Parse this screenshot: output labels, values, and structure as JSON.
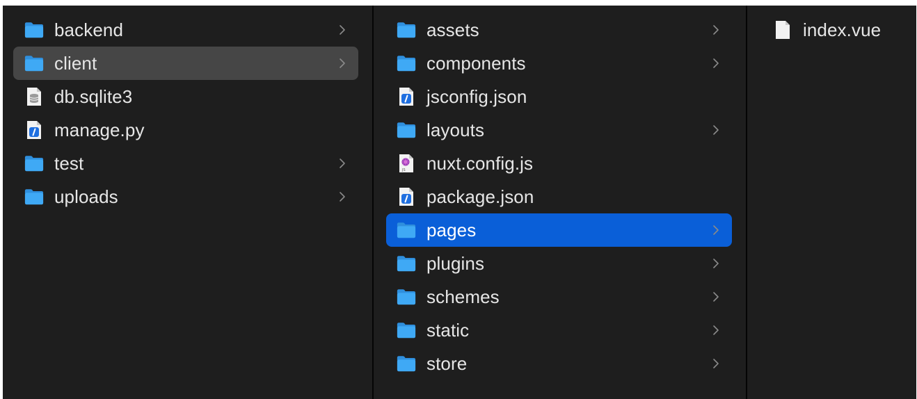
{
  "colors": {
    "background": "#1e1e1e",
    "text": "#e6e6e6",
    "selection_active": "#0a5fd8",
    "selection_inactive": "#464646",
    "folder": "#3fa9f5",
    "chevron": "#8a8a8a"
  },
  "columns": [
    {
      "items": [
        {
          "label": "backend",
          "icon": "folder-icon",
          "has_children": true,
          "state": "none"
        },
        {
          "label": "client",
          "icon": "folder-icon",
          "has_children": true,
          "state": "selected-inactive"
        },
        {
          "label": "db.sqlite3",
          "icon": "database-file-icon",
          "has_children": false,
          "state": "none"
        },
        {
          "label": "manage.py",
          "icon": "script-file-icon",
          "has_children": false,
          "state": "none"
        },
        {
          "label": "test",
          "icon": "folder-icon",
          "has_children": true,
          "state": "none"
        },
        {
          "label": "uploads",
          "icon": "folder-icon",
          "has_children": true,
          "state": "none"
        }
      ]
    },
    {
      "items": [
        {
          "label": "assets",
          "icon": "folder-icon",
          "has_children": true,
          "state": "none"
        },
        {
          "label": "components",
          "icon": "folder-icon",
          "has_children": true,
          "state": "none"
        },
        {
          "label": "jsconfig.json",
          "icon": "script-file-icon",
          "has_children": false,
          "state": "none"
        },
        {
          "label": "layouts",
          "icon": "folder-icon",
          "has_children": true,
          "state": "none"
        },
        {
          "label": "nuxt.config.js",
          "icon": "js-file-icon",
          "has_children": false,
          "state": "none"
        },
        {
          "label": "package.json",
          "icon": "script-file-icon",
          "has_children": false,
          "state": "none"
        },
        {
          "label": "pages",
          "icon": "folder-icon",
          "has_children": true,
          "state": "selected-active"
        },
        {
          "label": "plugins",
          "icon": "folder-icon",
          "has_children": true,
          "state": "none"
        },
        {
          "label": "schemes",
          "icon": "folder-icon",
          "has_children": true,
          "state": "none"
        },
        {
          "label": "static",
          "icon": "folder-icon",
          "has_children": true,
          "state": "none"
        },
        {
          "label": "store",
          "icon": "folder-icon",
          "has_children": true,
          "state": "none"
        }
      ]
    },
    {
      "items": [
        {
          "label": "index.vue",
          "icon": "document-icon",
          "has_children": false,
          "state": "none"
        }
      ]
    }
  ]
}
